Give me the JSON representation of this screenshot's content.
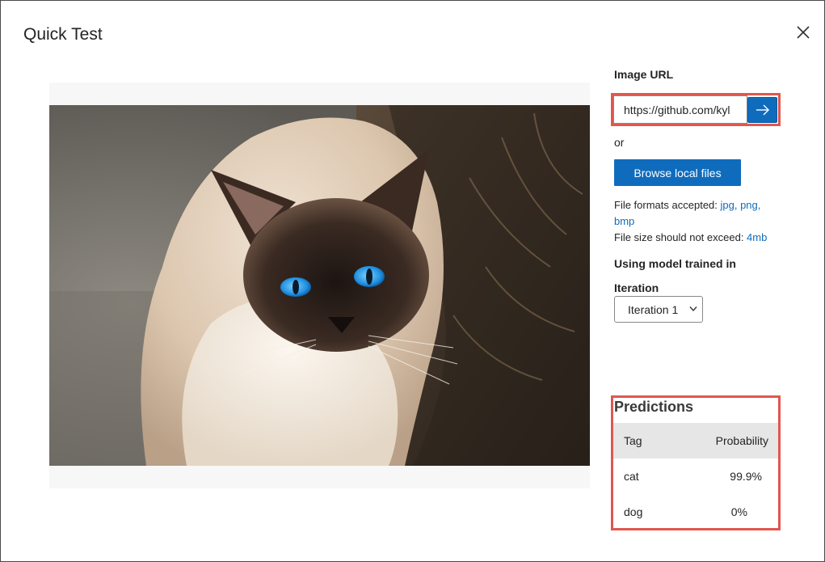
{
  "dialog": {
    "title": "Quick Test"
  },
  "image_url": {
    "label": "Image URL",
    "value": "https://github.com/kyl",
    "submit_icon": "arrow-right-icon"
  },
  "or_text": "or",
  "browse": {
    "label": "Browse local files"
  },
  "file_info": {
    "formats_prefix": "File formats accepted: ",
    "formats_line1": "jpg, png,",
    "formats_line2": "bmp",
    "size_prefix": "File size should not exceed: ",
    "size_value": "4mb"
  },
  "model": {
    "heading": "Using model trained in",
    "iteration_label": "Iteration",
    "iteration_selected": "Iteration 1"
  },
  "predictions": {
    "title": "Predictions",
    "columns": [
      "Tag",
      "Probability"
    ],
    "rows": [
      {
        "tag": "cat",
        "probability": "99.9%"
      },
      {
        "tag": "dog",
        "probability": "0%"
      }
    ]
  },
  "colors": {
    "accent": "#0f6cbd",
    "highlight": "#e0574f"
  }
}
